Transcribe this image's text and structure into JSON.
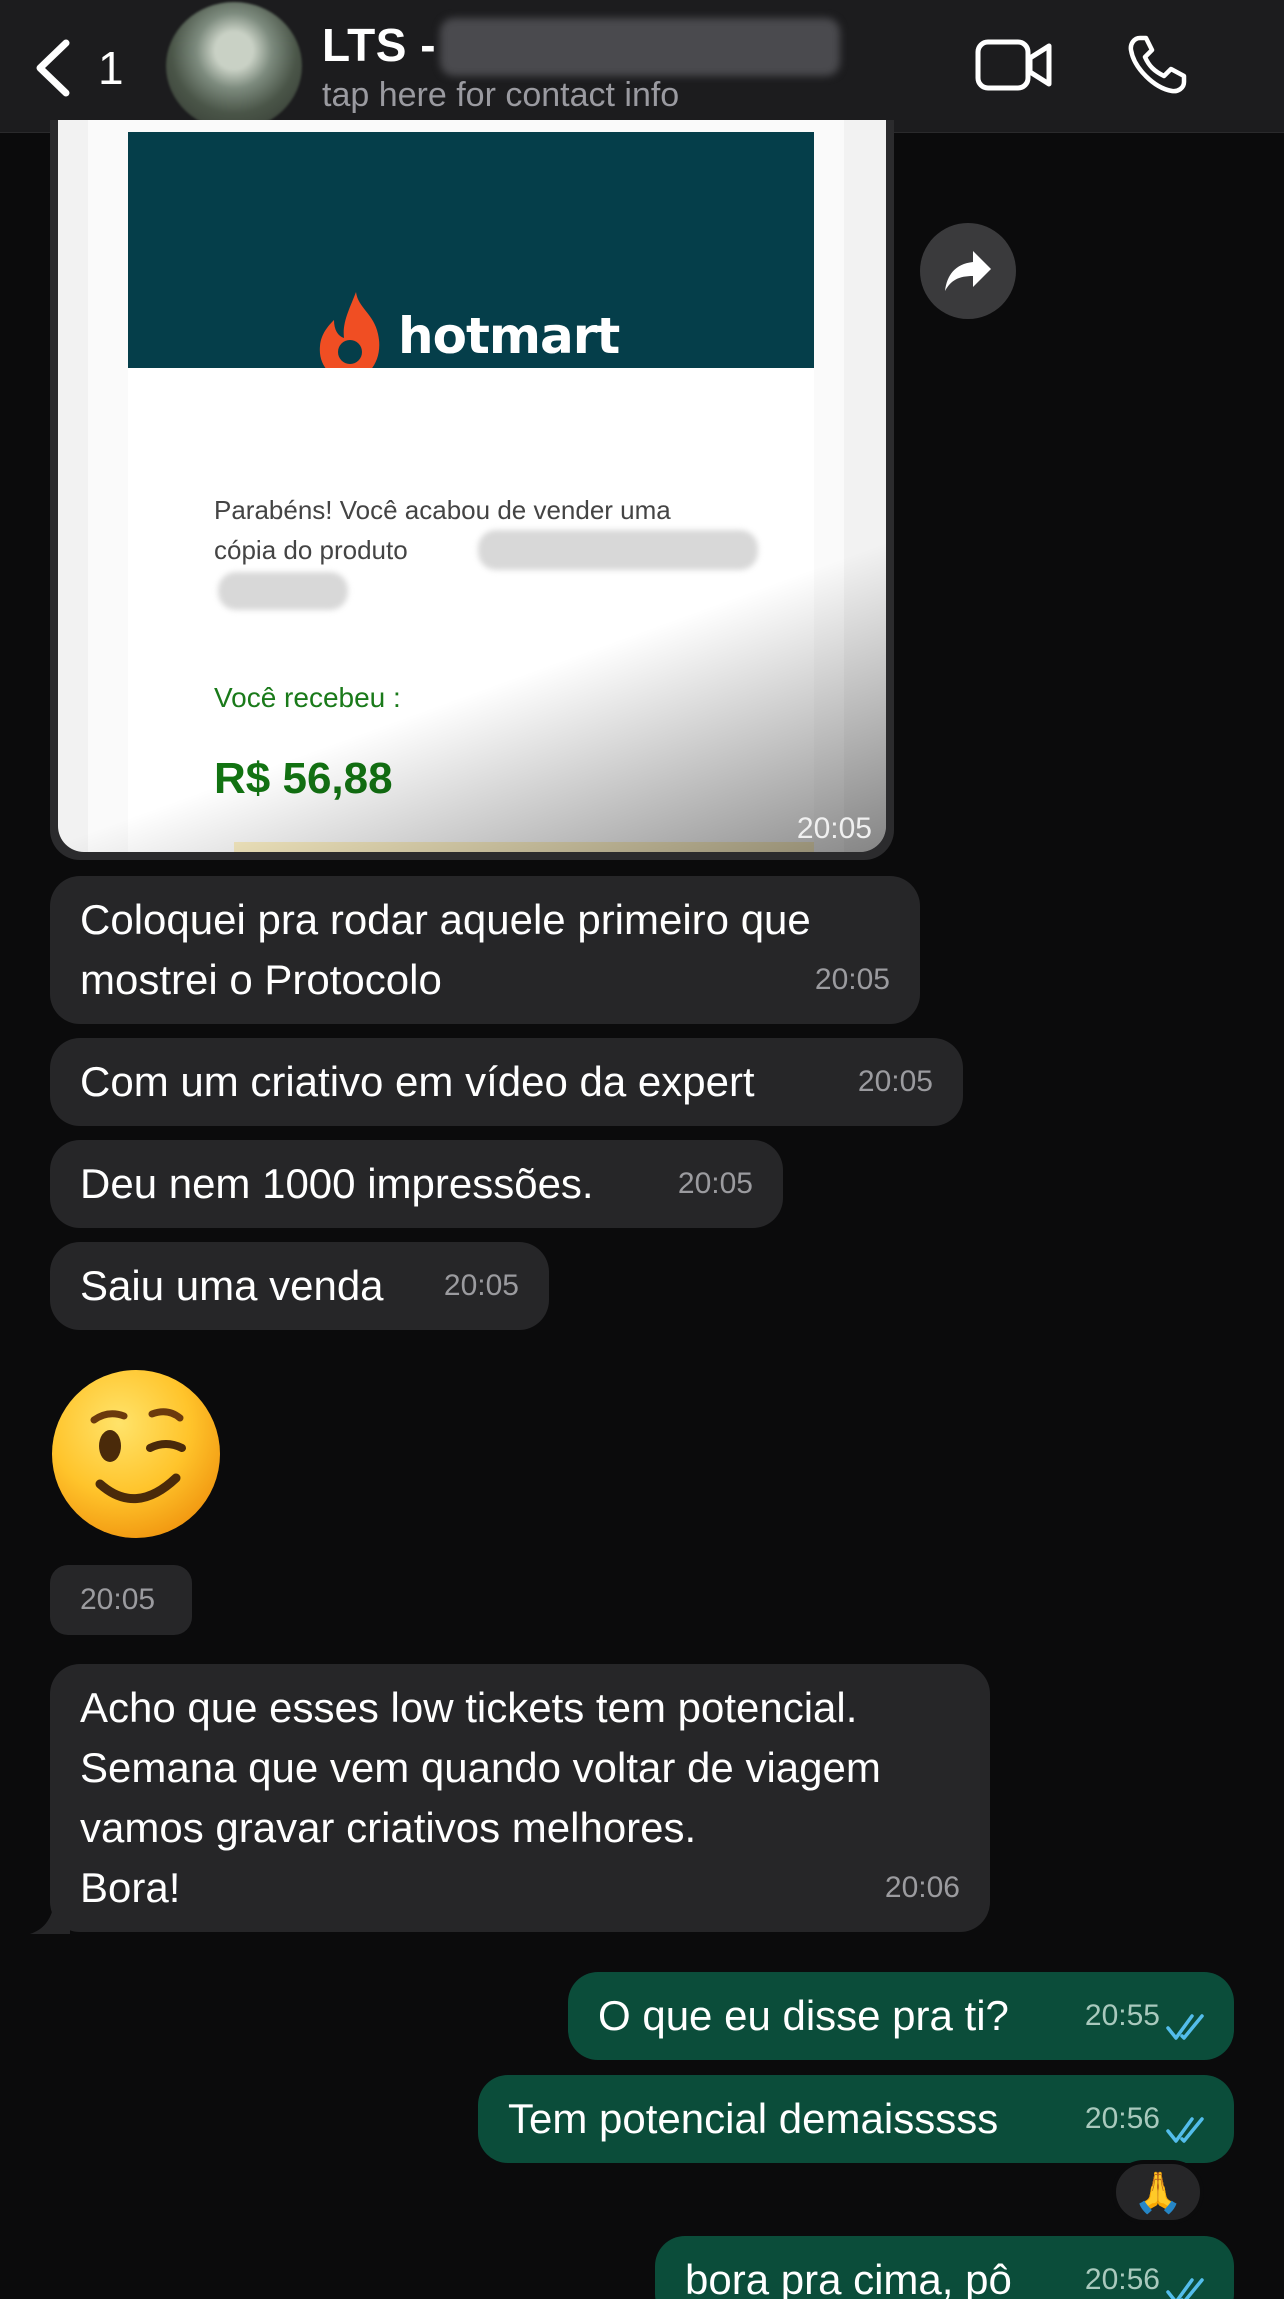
{
  "header": {
    "back_count": "1",
    "contact_name": "LTS -",
    "subtitle": "tap here for contact info"
  },
  "image_message": {
    "brand": "hotmart",
    "body_text": "Parabéns! Você acabou de vender uma cópia do produto",
    "received_label": "Você recebeu :",
    "amount": "R$ 56,88",
    "time": "20:05"
  },
  "messages": [
    {
      "direction": "in",
      "text_lines": [
        "Coloquei pra rodar aquele primeiro que",
        "mostrei o Protocolo"
      ],
      "time": "20:05"
    },
    {
      "direction": "in",
      "text": "Com um criativo em vídeo da expert",
      "time": "20:05"
    },
    {
      "direction": "in",
      "text": "Deu nem 1000 impressões.",
      "time": "20:05"
    },
    {
      "direction": "in",
      "text": "Saiu uma venda",
      "time": "20:05"
    },
    {
      "direction": "in",
      "emoji": "😉",
      "time": "20:05"
    },
    {
      "direction": "in",
      "text_lines": [
        "Acho que esses low tickets tem potencial.",
        "Semana que vem quando voltar de viagem",
        "vamos gravar criativos melhores.",
        "Bora!"
      ],
      "time": "20:06"
    },
    {
      "direction": "out",
      "text": "O que eu disse pra ti?",
      "time": "20:55",
      "status": "read"
    },
    {
      "direction": "out",
      "text": "Tem potencial demaisssss",
      "time": "20:56",
      "status": "read",
      "reaction": "🙏"
    },
    {
      "direction": "out",
      "text": "bora pra cima, pô",
      "time": "20:56",
      "status": "read"
    }
  ],
  "colors": {
    "background": "#0b0b0c",
    "incoming_bubble": "#262628",
    "outgoing_bubble": "#0b4d3a",
    "read_tick": "#53bdeb",
    "hotmart_orange": "#f04e23"
  },
  "icons": [
    "back-chevron-icon",
    "video-call-icon",
    "phone-call-icon",
    "forward-icon",
    "read-receipt-icon"
  ]
}
